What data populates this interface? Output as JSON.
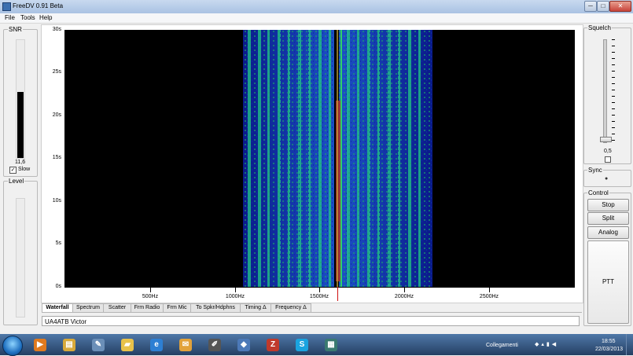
{
  "window": {
    "title": "FreeDV 0.91 Beta",
    "minimize": "─",
    "maximize": "□",
    "close": "✕"
  },
  "menu": [
    "File",
    "Tools",
    "Help"
  ],
  "snr": {
    "label": "SNR",
    "value": "11,6",
    "slow_label": "Slow",
    "slow_checked": true
  },
  "level": {
    "label": "Level"
  },
  "waterfall": {
    "y_ticks": [
      "30s",
      "25s",
      "20s",
      "15s",
      "10s",
      "5s",
      "0s"
    ],
    "x_ticks": [
      "500Hz",
      "1000Hz",
      "1500Hz",
      "2000Hz",
      "2500Hz"
    ],
    "cursor_hz": 1520
  },
  "tabs": [
    "Waterfall",
    "Spectrum",
    "Scatter",
    "Frm Radio",
    "Frm Mic",
    "To Spkr/Hdphns",
    "Timing Δ",
    "Frequency Δ"
  ],
  "active_tab": "Waterfall",
  "callsign_text": "UA4ATB  Victor",
  "squelch": {
    "label": "Squelch",
    "value": "0,5"
  },
  "sync": {
    "label": "Sync",
    "indicator": "●"
  },
  "control": {
    "label": "Control",
    "stop": "Stop",
    "split": "Split",
    "analog": "Analog",
    "ptt": "PTT"
  },
  "taskbar": {
    "tray_label": "Collegamenti",
    "time": "18:55",
    "date": "22/03/2013",
    "apps": [
      {
        "icon": "media-player-icon",
        "glyph": "▶",
        "color": "#e07a1f"
      },
      {
        "icon": "file-explorer-icon",
        "glyph": "▤",
        "color": "#d7a93a"
      },
      {
        "icon": "tool-icon",
        "glyph": "✎",
        "color": "#6b8fb8"
      },
      {
        "icon": "folder-icon",
        "glyph": "▰",
        "color": "#e8c24a"
      },
      {
        "icon": "internet-explorer-icon",
        "glyph": "e",
        "color": "#2d7fd3"
      },
      {
        "icon": "mail-icon",
        "glyph": "✉",
        "color": "#e2a23a"
      },
      {
        "icon": "pen-icon",
        "glyph": "✐",
        "color": "#555"
      },
      {
        "icon": "shield-icon",
        "glyph": "◆",
        "color": "#4c79b8"
      },
      {
        "icon": "filezilla-icon",
        "glyph": "Z",
        "color": "#c0392b"
      },
      {
        "icon": "skype-icon",
        "glyph": "S",
        "color": "#1aa4e0"
      },
      {
        "icon": "freedv-icon",
        "glyph": "▦",
        "color": "#3a7a70"
      }
    ]
  }
}
